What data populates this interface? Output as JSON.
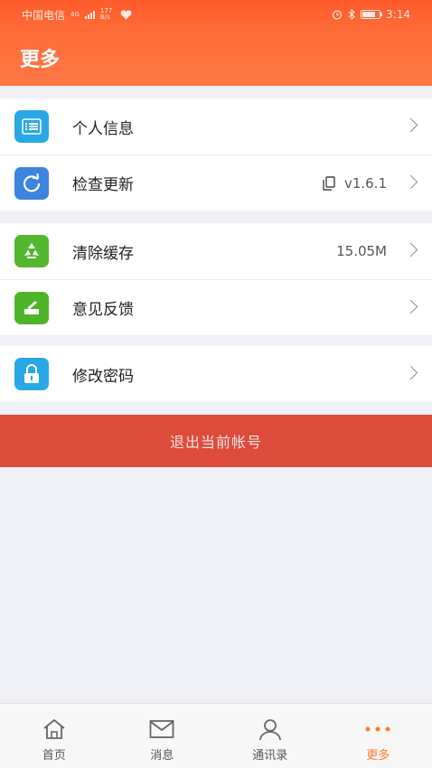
{
  "status": {
    "carrier": "中国电信",
    "network": "4G",
    "speed_value": "177",
    "speed_unit": "B/s",
    "time": "3:14"
  },
  "header": {
    "title": "更多"
  },
  "menu": {
    "profile": {
      "label": "个人信息",
      "icon": "list-icon",
      "color": "#29a8e6"
    },
    "update": {
      "label": "检查更新",
      "value": "v1.6.1",
      "icon": "refresh-icon",
      "color": "#3d83e0"
    },
    "cache": {
      "label": "清除缓存",
      "value": "15.05M",
      "icon": "recycle-icon",
      "color": "#53b82f"
    },
    "feedback": {
      "label": "意见反馈",
      "icon": "feedback-icon",
      "color": "#4eb529"
    },
    "password": {
      "label": "修改密码",
      "icon": "lock-icon",
      "color": "#29a8e6"
    }
  },
  "logout": {
    "label": "退出当前帐号",
    "color": "#dd4b3b"
  },
  "tabs": [
    {
      "label": "首页",
      "icon": "home-icon"
    },
    {
      "label": "消息",
      "icon": "mail-icon"
    },
    {
      "label": "通讯录",
      "icon": "contacts-icon"
    },
    {
      "label": "更多",
      "icon": "more-icon",
      "active": true
    }
  ],
  "accent": "#ff7a2a"
}
